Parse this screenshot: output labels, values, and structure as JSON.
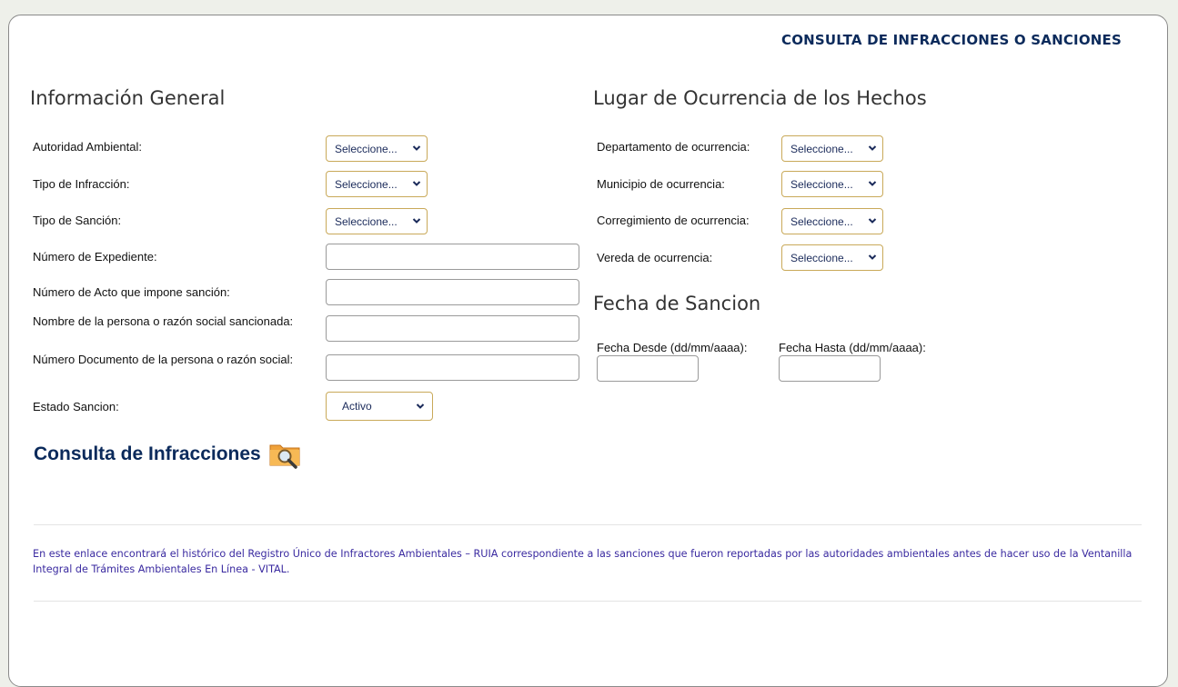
{
  "page_title": "CONSULTA DE INFRACCIONES O SANCIONES",
  "general": {
    "heading": "Información General",
    "fields": [
      {
        "label": "Autoridad Ambiental:",
        "type": "select",
        "value": "Seleccione..."
      },
      {
        "label": "Tipo de Infracción:",
        "type": "select",
        "value": "Seleccione..."
      },
      {
        "label": "Tipo de Sanción:",
        "type": "select",
        "value": "Seleccione..."
      },
      {
        "label": "Número de Expediente:",
        "type": "text",
        "value": ""
      },
      {
        "label": "Número de Acto que impone sanción:",
        "type": "text",
        "value": ""
      },
      {
        "label": "Nombre de la persona o razón social sancionada:",
        "type": "text",
        "value": ""
      },
      {
        "label": "Número Documento de la persona o razón social:",
        "type": "text",
        "value": ""
      },
      {
        "label": "Estado Sancion:",
        "type": "select",
        "value": "Activo"
      }
    ]
  },
  "location": {
    "heading": "Lugar de Ocurrencia de los Hechos",
    "fields": [
      {
        "label": "Departamento de ocurrencia:",
        "type": "select",
        "value": "Seleccione..."
      },
      {
        "label": "Municipio de ocurrencia:",
        "type": "select",
        "value": "Seleccione..."
      },
      {
        "label": "Corregimiento de ocurrencia:",
        "type": "select",
        "value": "Seleccione..."
      },
      {
        "label": "Vereda de ocurrencia:",
        "type": "select",
        "value": "Seleccione..."
      }
    ]
  },
  "dates": {
    "heading": "Fecha de Sancion",
    "from_label": "Fecha Desde (dd/mm/aaaa):",
    "to_label": "Fecha Hasta (dd/mm/aaaa):",
    "from_value": "",
    "to_value": ""
  },
  "query_link": {
    "label": "Consulta de Infracciones",
    "icon": "folder-search-icon"
  },
  "note": "En este enlace encontrará el histórico del Registro Único de Infractores Ambientales – RUIA correspondiente a las sanciones que fueron reportadas por las autoridades ambientales antes de hacer uso de la Ventanilla Integral de Trámites Ambientales En Línea - VITAL.",
  "colors": {
    "title": "#0b2a5b",
    "select_border": "#c9a959",
    "note": "#3a2aa0"
  }
}
